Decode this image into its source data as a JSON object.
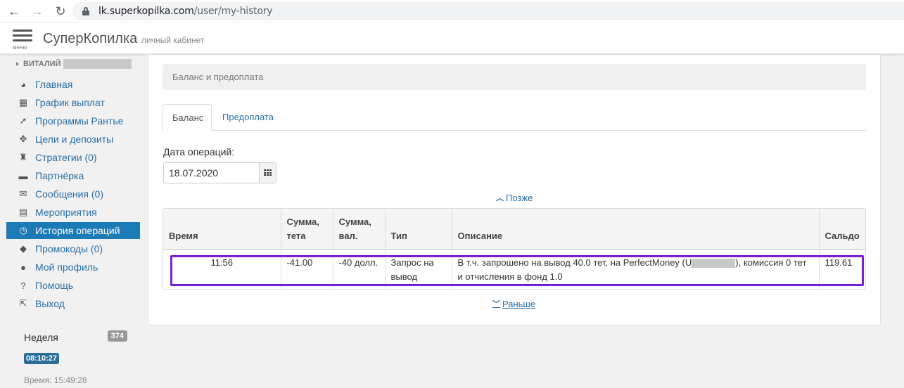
{
  "browser": {
    "url_host": "lk.superkopilka.com",
    "url_path": "/user/my-history"
  },
  "header": {
    "menu_label": "меню",
    "brand": "СуперКопилка",
    "brand_sub": "личный кабинет"
  },
  "sidebar": {
    "user_name": "ВИТАЛИЙ",
    "items": [
      {
        "label": "Главная",
        "icon": "dashboard-icon",
        "glyph": "◕"
      },
      {
        "label": "График выплат",
        "icon": "calendar-icon",
        "glyph": "▦"
      },
      {
        "label": "Программы Рантье",
        "icon": "rocket-icon",
        "glyph": "➚"
      },
      {
        "label": "Цели и депозиты",
        "icon": "crosshairs-icon",
        "glyph": "✥"
      },
      {
        "label": "Стратегии (0)",
        "icon": "chess-icon",
        "glyph": "♜"
      },
      {
        "label": "Партнёрка",
        "icon": "briefcase-icon",
        "glyph": "▬"
      },
      {
        "label": "Сообщения (0)",
        "icon": "envelope-icon",
        "glyph": "✉"
      },
      {
        "label": "Мероприятия",
        "icon": "film-icon",
        "glyph": "▤"
      },
      {
        "label": "История операций",
        "icon": "clock-icon",
        "glyph": "◷",
        "active": true
      },
      {
        "label": "Промокоды (0)",
        "icon": "tag-icon",
        "glyph": "◆"
      },
      {
        "label": "Мой профиль",
        "icon": "user-icon",
        "glyph": "●"
      },
      {
        "label": "Помощь",
        "icon": "question-icon",
        "glyph": "?"
      },
      {
        "label": "Выход",
        "icon": "sign-out-icon",
        "glyph": "⇱"
      }
    ],
    "week_label": "Неделя",
    "week_count": "374",
    "timer": "08:10:27",
    "time_label": "Время:",
    "time_value": "15:49:28"
  },
  "main": {
    "panel_title": "Баланс и предоплата",
    "tabs": [
      {
        "label": "Баланс",
        "active": true
      },
      {
        "label": "Предоплата",
        "active": false
      }
    ],
    "date_label": "Дата операций:",
    "date_value": "18.07.2020",
    "later_label": "Позже",
    "earlier_label": "Раньше",
    "table": {
      "headers": {
        "time": "Время",
        "sum_teta_1": "Сумма,",
        "sum_teta_2": "тета",
        "sum_val_1": "Сумма,",
        "sum_val_2": "вал.",
        "type": "Тип",
        "description": "Описание",
        "balance": "Сальдо"
      },
      "rows": [
        {
          "time": "11:56",
          "sum_teta": "-41.00",
          "sum_val": "-40 долл.",
          "type": "Запрос на вывод",
          "description_prefix": "В т.ч. запрошено на вывод 40.0 тет, на PerfectMoney (U",
          "description_suffix": "), комиссия 0 тет и отчисления в фонд 1.0",
          "balance": "119.61"
        }
      ]
    },
    "highlight_color": "#7a1fd1"
  }
}
